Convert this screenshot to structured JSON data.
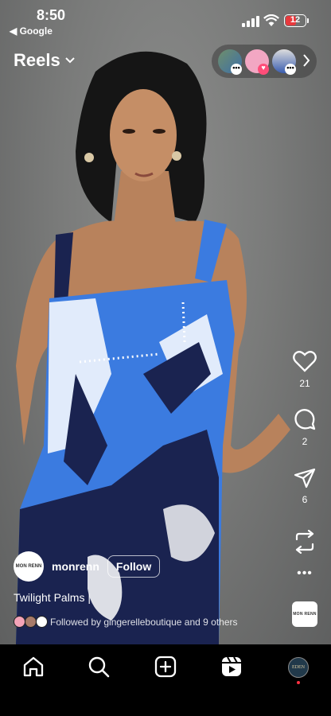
{
  "status_bar": {
    "time": "8:50",
    "back_app": "◀ Google",
    "battery": "12"
  },
  "header": {
    "title": "Reels"
  },
  "actions": {
    "likes": "21",
    "comments": "2",
    "shares": "6"
  },
  "reel": {
    "username": "monrenn",
    "follow_label": "Follow",
    "caption": "Twilight Palms |",
    "followed_by": "Followed by gingerelleboutique and 9 others",
    "avatar_text": "MON RENN",
    "audio_text": "MON RENN"
  },
  "tabbar": {
    "profile_text": "EDEN"
  },
  "colors": {
    "accent_red": "#ff3040",
    "dress_blue": "#3b7be0",
    "dress_navy": "#1a2350"
  }
}
